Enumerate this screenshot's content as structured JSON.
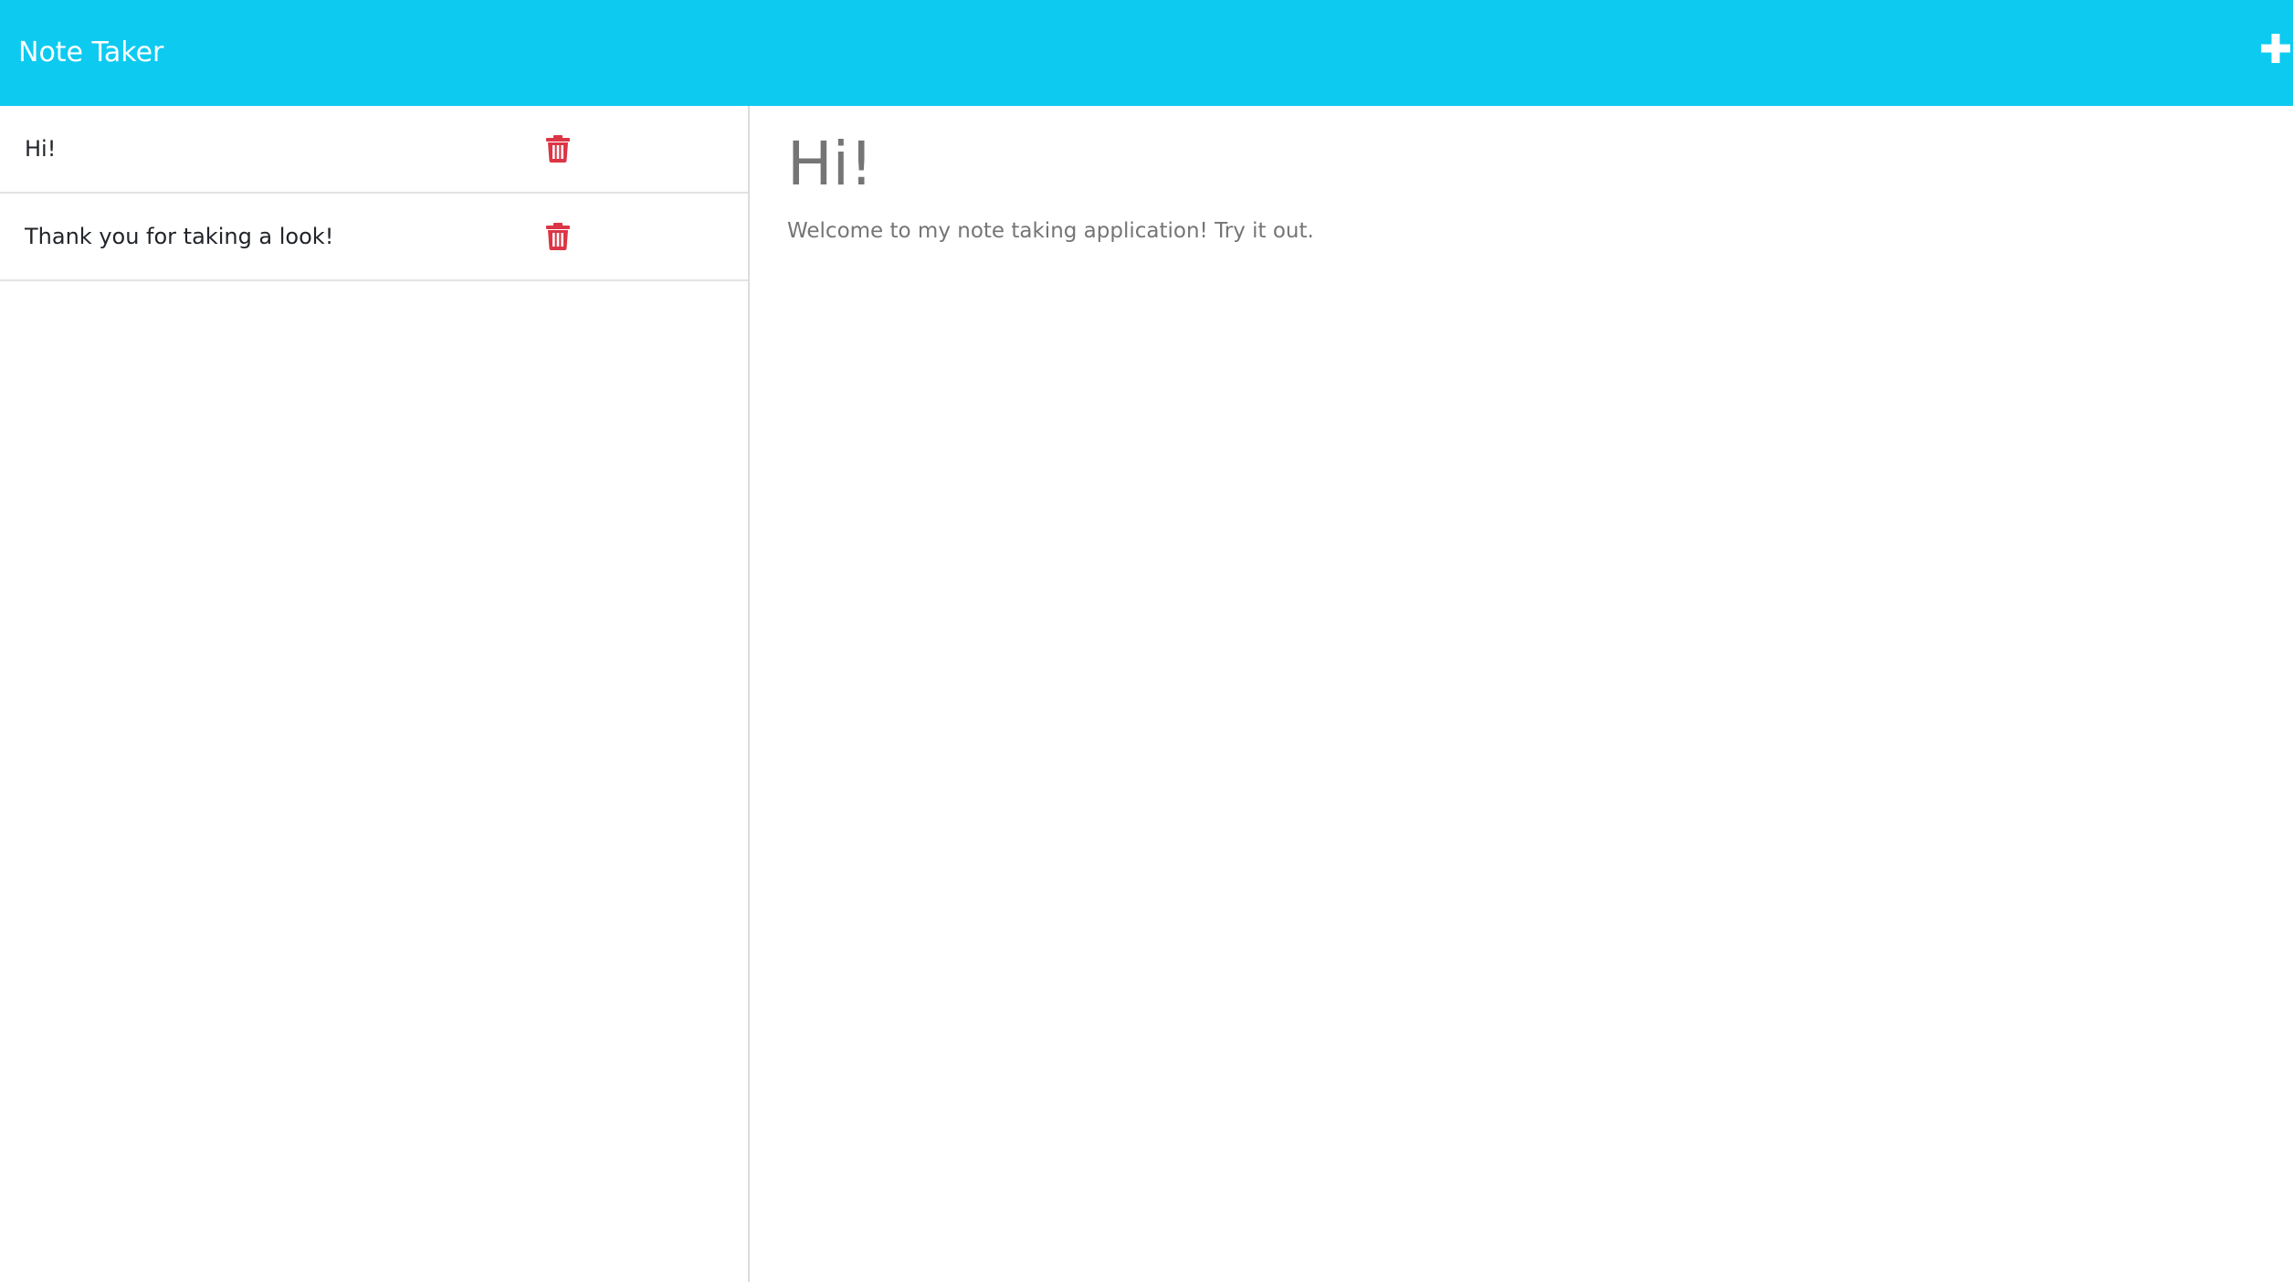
{
  "app": {
    "title": "Note Taker"
  },
  "header": {
    "new_note_icon": "plus-icon"
  },
  "colors": {
    "navbar": "#0dcaf0",
    "delete_icon": "#dc3545",
    "note_text": "#757575"
  },
  "notes": [
    {
      "title": "Hi!",
      "delete_icon": "trash-icon"
    },
    {
      "title": "Thank you for taking a look!",
      "delete_icon": "trash-icon"
    }
  ],
  "active_note": {
    "title": "Hi!",
    "text": "Welcome to my note taking application! Try it out."
  }
}
